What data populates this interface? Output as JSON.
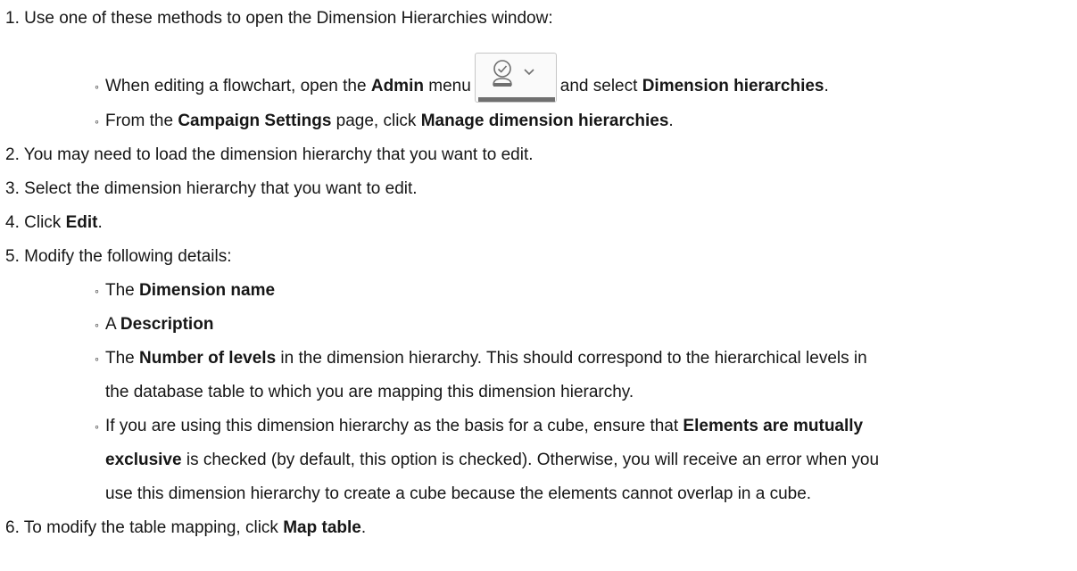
{
  "steps": {
    "s1": {
      "num": "1.",
      "text": "Use one of these methods to open the Dimension Hierarchies window:"
    },
    "s1a": {
      "t1": "When editing a flowchart, open the ",
      "b1": "Admin",
      "t2": " menu",
      "t3": "and select ",
      "b2": "Dimension hierarchies",
      "t4": "."
    },
    "s1b": {
      "t1": "From the ",
      "b1": "Campaign Settings",
      "t2": " page, click ",
      "b2": "Manage dimension hierarchies",
      "t3": "."
    },
    "s2": {
      "num": "2.",
      "text": "You may need to load the dimension hierarchy that you want to edit."
    },
    "s3": {
      "num": "3.",
      "text": "Select the dimension hierarchy that you want to edit."
    },
    "s4": {
      "num": "4.",
      "t1": "Click ",
      "b1": "Edit",
      "t2": "."
    },
    "s5": {
      "num": "5.",
      "text": "Modify the following details:"
    },
    "s5a": {
      "t1": "The ",
      "b1": "Dimension name"
    },
    "s5b": {
      "t1": "A ",
      "b1": "Description"
    },
    "s5c": {
      "t1": "The ",
      "b1": "Number of levels",
      "t2": " in the dimension hierarchy. This should correspond to the hierarchical levels in",
      "l2": "the database table to which you are mapping this dimension hierarchy."
    },
    "s5d": {
      "t1": "If you are using this dimension hierarchy as the basis for a cube, ensure that ",
      "b1": "Elements are mutually",
      "b2": "exclusive",
      "t2": " is checked (by default, this option is checked). Otherwise, you will receive an error when you",
      "l3": "use this dimension hierarchy to create a cube because the elements cannot overlap in a cube."
    },
    "s6": {
      "num": "6.",
      "t1": "To modify the table mapping, click ",
      "b1": "Map table",
      "t2": "."
    }
  },
  "bullet_glyph": "◦",
  "icons": {
    "admin_menu": "admin-user-check-icon",
    "chevron": "chevron-down-icon"
  }
}
